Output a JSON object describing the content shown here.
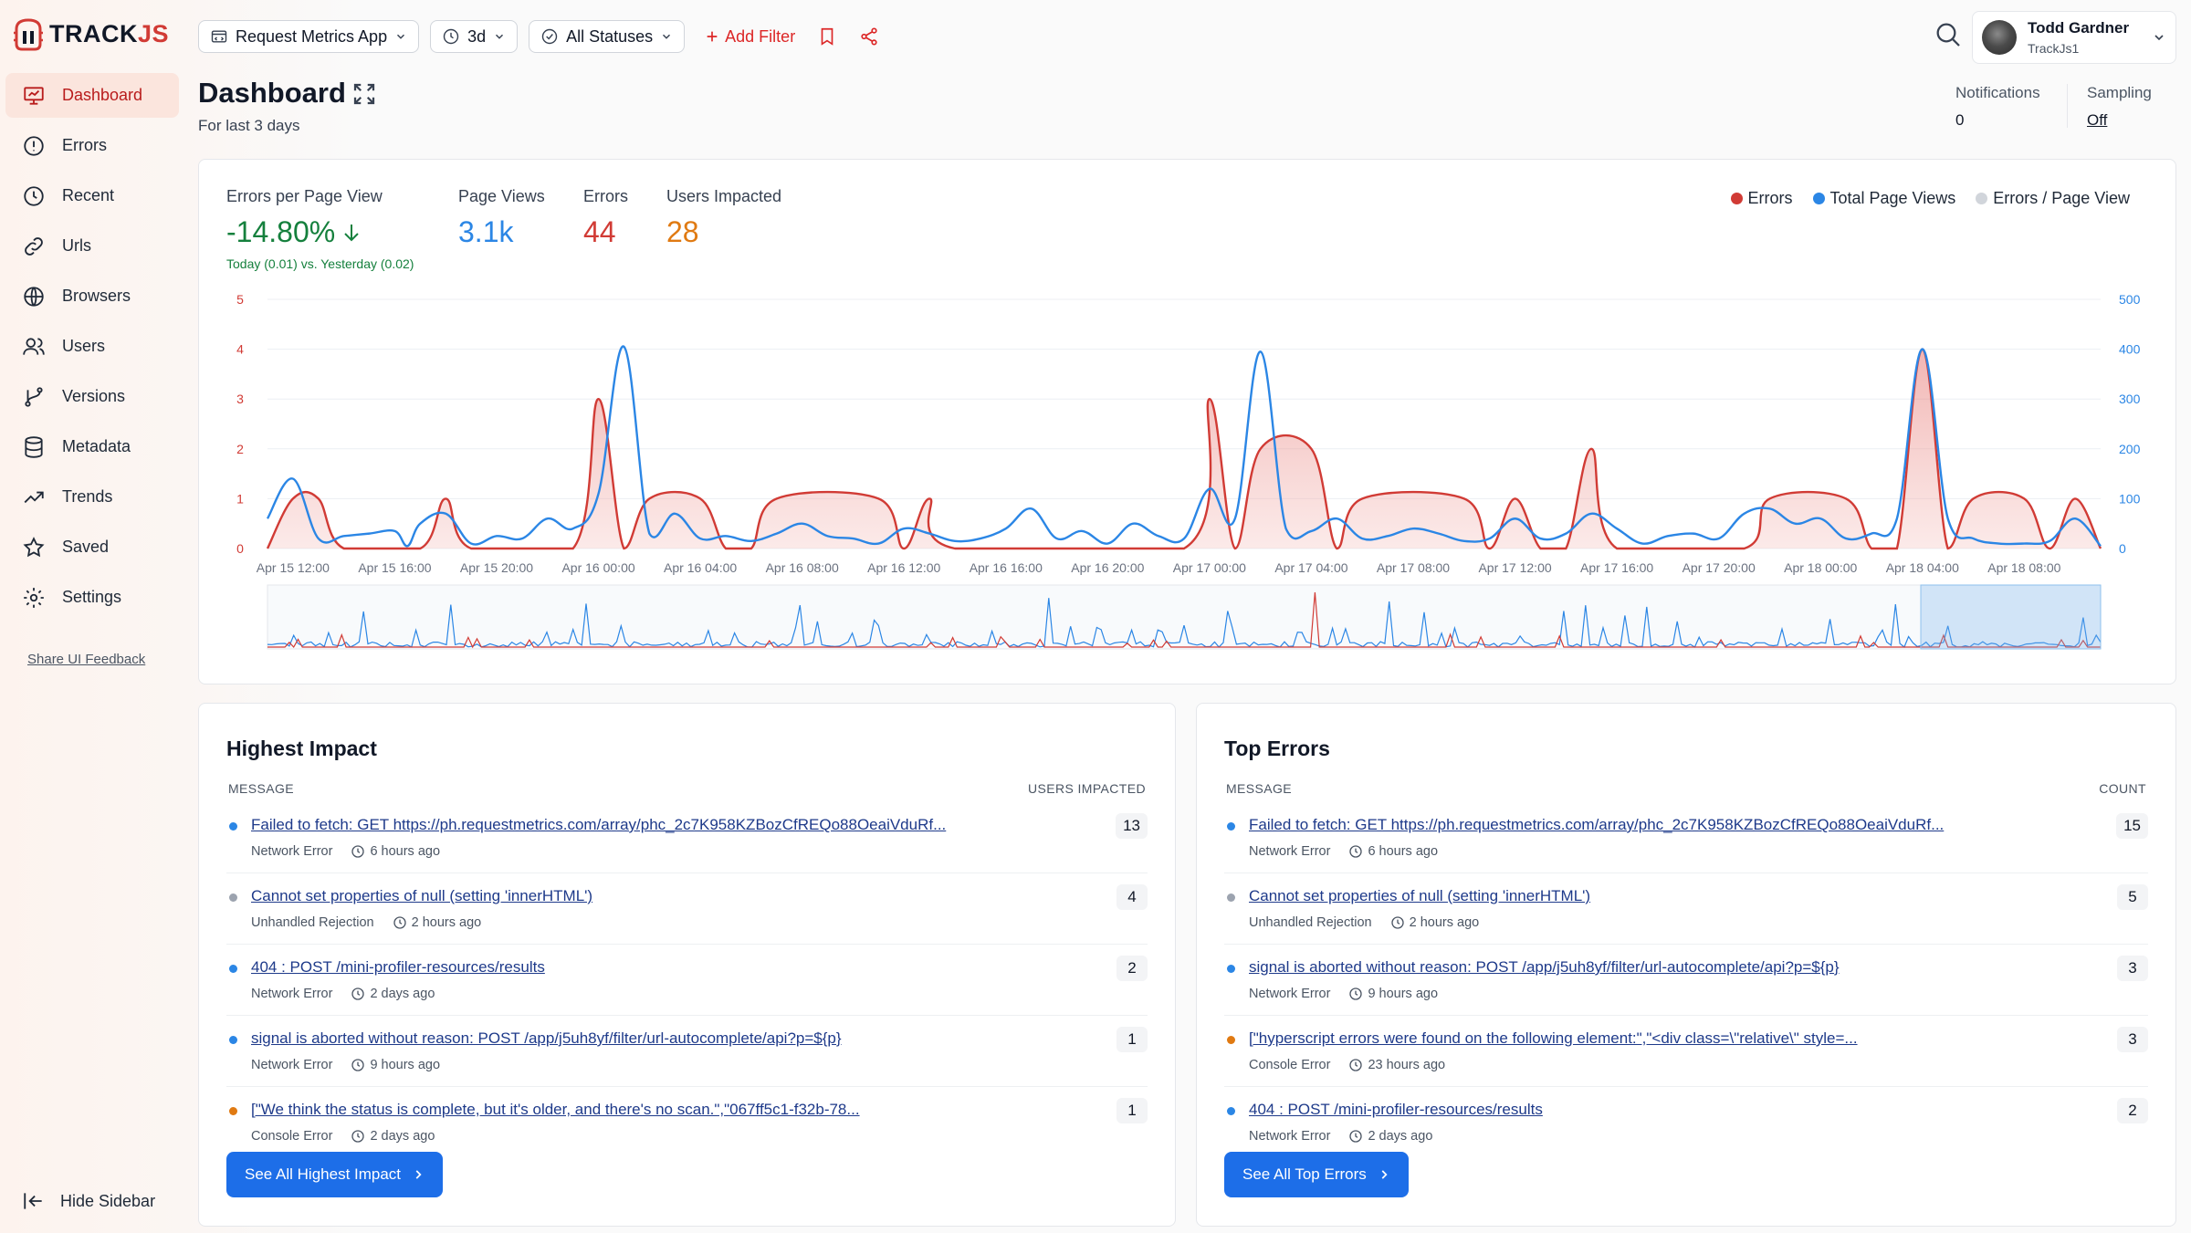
{
  "brand": {
    "name_main": "TRACK",
    "name_accent": "JS"
  },
  "nav": {
    "items": [
      {
        "label": "Dashboard",
        "icon": "dashboard-icon",
        "active": true
      },
      {
        "label": "Errors",
        "icon": "error-circle-icon"
      },
      {
        "label": "Recent",
        "icon": "clock-icon"
      },
      {
        "label": "Urls",
        "icon": "link-icon"
      },
      {
        "label": "Browsers",
        "icon": "globe-icon"
      },
      {
        "label": "Users",
        "icon": "users-icon"
      },
      {
        "label": "Versions",
        "icon": "git-branch-icon"
      },
      {
        "label": "Metadata",
        "icon": "database-icon"
      },
      {
        "label": "Trends",
        "icon": "trend-icon"
      },
      {
        "label": "Saved",
        "icon": "star-icon"
      },
      {
        "label": "Settings",
        "icon": "gear-icon"
      }
    ],
    "feedback_label": "Share UI Feedback",
    "hide_sidebar_label": "Hide Sidebar"
  },
  "toolbar": {
    "app_select": "Request Metrics App",
    "range_select": "3d",
    "status_select": "All Statuses",
    "add_filter": "Add Filter"
  },
  "user": {
    "name": "Todd Gardner",
    "org": "TrackJs1"
  },
  "header": {
    "title": "Dashboard",
    "subtitle": "For last 3 days",
    "notifications_label": "Notifications",
    "notifications_value": "0",
    "sampling_label": "Sampling",
    "sampling_value": "Off"
  },
  "stats": {
    "epv_label": "Errors per Page View",
    "epv_value": "-14.80%",
    "epv_sub": "Today (0.01) vs. Yesterday (0.02)",
    "pv_label": "Page Views",
    "pv_value": "3.1k",
    "errors_label": "Errors",
    "errors_value": "44",
    "users_label": "Users Impacted",
    "users_value": "28"
  },
  "colors": {
    "errors": "#d13b35",
    "page_views": "#2b86e5",
    "ratio": "#d1d5db",
    "green": "#15803d",
    "orange": "#e07a12"
  },
  "chart_data": {
    "type": "line",
    "legend": [
      "Errors",
      "Total Page Views",
      "Errors / Page View"
    ],
    "legend_position": "top-right",
    "grid": true,
    "x_labels": [
      "Apr 15 12:00",
      "Apr 15 16:00",
      "Apr 15 20:00",
      "Apr 16 00:00",
      "Apr 16 04:00",
      "Apr 16 08:00",
      "Apr 16 12:00",
      "Apr 16 16:00",
      "Apr 16 20:00",
      "Apr 17 00:00",
      "Apr 17 04:00",
      "Apr 17 08:00",
      "Apr 17 12:00",
      "Apr 17 16:00",
      "Apr 17 20:00",
      "Apr 18 00:00",
      "Apr 18 04:00",
      "Apr 18 08:00"
    ],
    "y_left": {
      "ticks": [
        "0",
        "1",
        "2",
        "3",
        "4",
        "5"
      ],
      "range": [
        0,
        5
      ]
    },
    "y_right": {
      "ticks": [
        "0",
        "100",
        "200",
        "300",
        "400",
        "500"
      ],
      "range": [
        0,
        500
      ]
    },
    "x_hours_range": [
      -1,
      71
    ],
    "series": [
      {
        "name": "Errors",
        "axis": "left",
        "points": [
          [
            -1,
            0
          ],
          [
            0,
            1
          ],
          [
            1,
            1
          ],
          [
            2,
            0
          ],
          [
            5,
            0
          ],
          [
            6,
            1
          ],
          [
            7,
            0
          ],
          [
            11,
            0
          ],
          [
            12,
            3
          ],
          [
            13,
            0
          ],
          [
            14,
            1
          ],
          [
            16,
            1
          ],
          [
            17,
            0
          ],
          [
            18,
            0
          ],
          [
            19,
            1
          ],
          [
            23,
            1
          ],
          [
            24,
            0
          ],
          [
            25,
            1
          ],
          [
            26,
            0
          ],
          [
            35,
            0
          ],
          [
            36,
            3
          ],
          [
            37,
            0
          ],
          [
            38,
            2
          ],
          [
            40,
            2
          ],
          [
            41,
            0
          ],
          [
            42,
            1
          ],
          [
            46,
            1
          ],
          [
            47,
            0
          ],
          [
            48,
            1
          ],
          [
            49,
            0
          ],
          [
            50,
            0
          ],
          [
            51,
            2
          ],
          [
            52,
            0
          ],
          [
            57,
            0
          ],
          [
            58,
            1
          ],
          [
            61,
            1
          ],
          [
            62,
            0
          ],
          [
            63,
            0
          ],
          [
            64,
            4
          ],
          [
            65,
            0
          ],
          [
            66,
            1
          ],
          [
            68,
            1
          ],
          [
            69,
            0
          ],
          [
            70,
            1
          ],
          [
            71,
            0
          ]
        ]
      },
      {
        "name": "Total Page Views",
        "axis": "right",
        "points": [
          [
            -1,
            60
          ],
          [
            0,
            140
          ],
          [
            1,
            20
          ],
          [
            2,
            25
          ],
          [
            3,
            30
          ],
          [
            4,
            35
          ],
          [
            4.5,
            5
          ],
          [
            5,
            50
          ],
          [
            6,
            70
          ],
          [
            7,
            10
          ],
          [
            8,
            25
          ],
          [
            9,
            20
          ],
          [
            10,
            60
          ],
          [
            11,
            40
          ],
          [
            12,
            110
          ],
          [
            13,
            405
          ],
          [
            14,
            30
          ],
          [
            15,
            70
          ],
          [
            16,
            20
          ],
          [
            17,
            25
          ],
          [
            18,
            15
          ],
          [
            19,
            30
          ],
          [
            20,
            50
          ],
          [
            21,
            25
          ],
          [
            22,
            20
          ],
          [
            23,
            10
          ],
          [
            24,
            40
          ],
          [
            25,
            30
          ],
          [
            26,
            15
          ],
          [
            27,
            20
          ],
          [
            28,
            40
          ],
          [
            29,
            80
          ],
          [
            30,
            20
          ],
          [
            31,
            35
          ],
          [
            32,
            10
          ],
          [
            33,
            50
          ],
          [
            34,
            25
          ],
          [
            35,
            20
          ],
          [
            36,
            120
          ],
          [
            37,
            60
          ],
          [
            38,
            395
          ],
          [
            39,
            40
          ],
          [
            40,
            35
          ],
          [
            41,
            60
          ],
          [
            42,
            20
          ],
          [
            43,
            25
          ],
          [
            44,
            40
          ],
          [
            45,
            30
          ],
          [
            46,
            15
          ],
          [
            47,
            20
          ],
          [
            48,
            60
          ],
          [
            49,
            20
          ],
          [
            50,
            30
          ],
          [
            51,
            70
          ],
          [
            52,
            40
          ],
          [
            53,
            10
          ],
          [
            54,
            25
          ],
          [
            55,
            30
          ],
          [
            56,
            20
          ],
          [
            57,
            70
          ],
          [
            58,
            80
          ],
          [
            59,
            50
          ],
          [
            60,
            60
          ],
          [
            61,
            20
          ],
          [
            62,
            30
          ],
          [
            63,
            60
          ],
          [
            64,
            400
          ],
          [
            65,
            60
          ],
          [
            66,
            20
          ],
          [
            67,
            10
          ],
          [
            68,
            10
          ],
          [
            69,
            15
          ],
          [
            70,
            60
          ],
          [
            71,
            5
          ]
        ]
      },
      {
        "name": "Errors / Page View",
        "axis": "left",
        "points": []
      }
    ]
  },
  "highest_impact": {
    "title": "Highest Impact",
    "col_message": "MESSAGE",
    "col_value": "USERS IMPACTED",
    "button": "See All Highest Impact",
    "rows": [
      {
        "message": "Failed to fetch: GET https://ph.requestmetrics.com/array/phc_2c7K958KZBozCfREQo88OeaiVduRf...",
        "type": "Network Error",
        "time": "6 hours ago",
        "count": "13",
        "dot": "#2b86e5"
      },
      {
        "message": "Cannot set properties of null (setting 'innerHTML')",
        "type": "Unhandled Rejection",
        "time": "2 hours ago",
        "count": "4",
        "dot": "#9ca3af"
      },
      {
        "message": "404 : POST /mini-profiler-resources/results",
        "type": "Network Error",
        "time": "2 days ago",
        "count": "2",
        "dot": "#2b86e5"
      },
      {
        "message": "signal is aborted without reason: POST /app/j5uh8yf/filter/url-autocomplete/api?p=${p}",
        "type": "Network Error",
        "time": "9 hours ago",
        "count": "1",
        "dot": "#2b86e5"
      },
      {
        "message": "[\"We think the status is complete, but it's older, and there's no scan.\",\"067ff5c1-f32b-78...",
        "type": "Console Error",
        "time": "2 days ago",
        "count": "1",
        "dot": "#e07a12"
      }
    ]
  },
  "top_errors": {
    "title": "Top Errors",
    "col_message": "MESSAGE",
    "col_value": "COUNT",
    "button": "See All Top Errors",
    "rows": [
      {
        "message": "Failed to fetch: GET https://ph.requestmetrics.com/array/phc_2c7K958KZBozCfREQo88OeaiVduRf...",
        "type": "Network Error",
        "time": "6 hours ago",
        "count": "15",
        "dot": "#2b86e5"
      },
      {
        "message": "Cannot set properties of null (setting 'innerHTML')",
        "type": "Unhandled Rejection",
        "time": "2 hours ago",
        "count": "5",
        "dot": "#9ca3af"
      },
      {
        "message": "signal is aborted without reason: POST /app/j5uh8yf/filter/url-autocomplete/api?p=${p}",
        "type": "Network Error",
        "time": "9 hours ago",
        "count": "3",
        "dot": "#2b86e5"
      },
      {
        "message": "[\"hyperscript errors were found on the following element:\",\"<div class=\\\"relative\\\" style=...",
        "type": "Console Error",
        "time": "23 hours ago",
        "count": "3",
        "dot": "#e07a12"
      },
      {
        "message": "404 : POST /mini-profiler-resources/results",
        "type": "Network Error",
        "time": "2 days ago",
        "count": "2",
        "dot": "#2b86e5"
      }
    ]
  }
}
